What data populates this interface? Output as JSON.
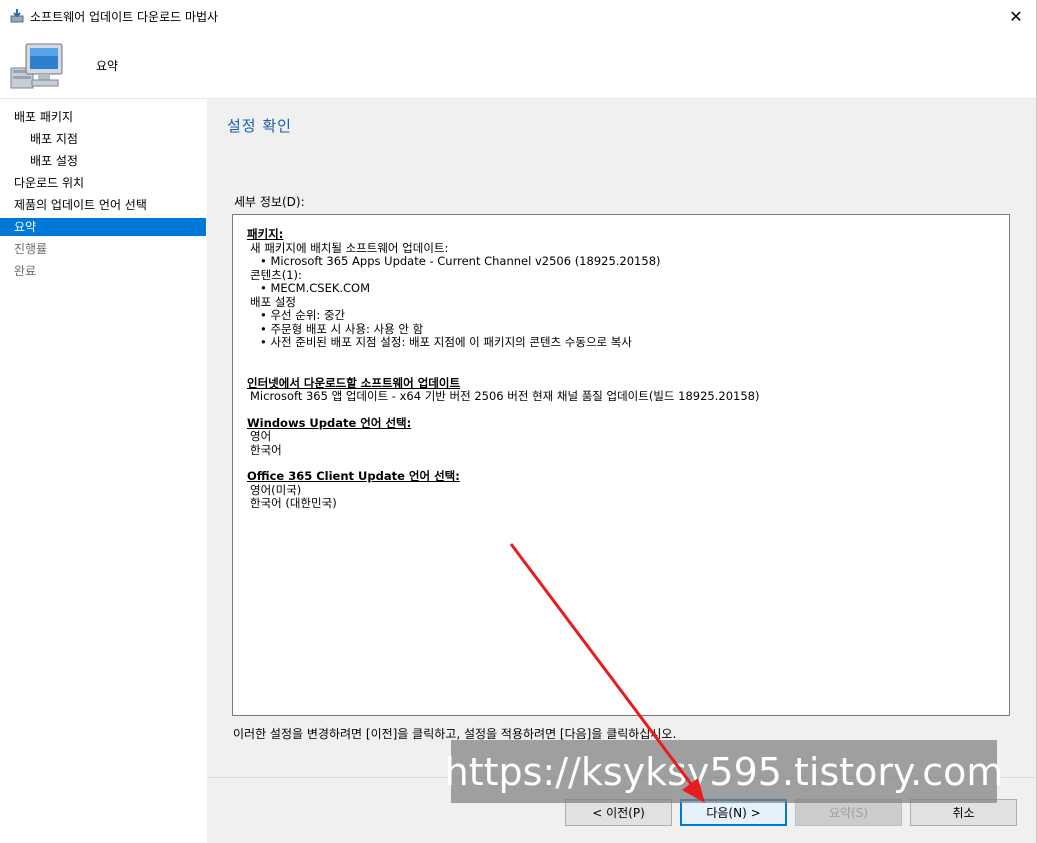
{
  "window": {
    "title": "소프트웨어 업데이트 다운로드 마법사",
    "close_glyph": "✕"
  },
  "header": {
    "title": "요약"
  },
  "nav": {
    "items": [
      {
        "label": "배포 패키지",
        "state": "normal"
      },
      {
        "label": "배포 지점",
        "state": "sub"
      },
      {
        "label": "배포 설정",
        "state": "sub"
      },
      {
        "label": "다운로드 위치",
        "state": "normal"
      },
      {
        "label": "제품의 업데이트 언어 선택",
        "state": "normal"
      },
      {
        "label": "요약",
        "state": "active"
      },
      {
        "label": "진행률",
        "state": "disabled"
      },
      {
        "label": "완료",
        "state": "disabled"
      }
    ]
  },
  "main": {
    "section_title": "설정 확인",
    "details_label": "세부 정보(D):",
    "details": {
      "package_heading": "패키지:",
      "package_sub1": "새 패키지에 배치될 소프트웨어 업데이트:",
      "package_sub1_item": "• Microsoft 365 Apps Update - Current Channel v2506 (18925.20158)",
      "content_label": "콘텐츠(1):",
      "content_item": "• MECM.CSEK.COM",
      "deploy_settings": "배포 설정",
      "deploy_item1": "• 우선 순위: 중간",
      "deploy_item2": "• 주문형 배포 시 사용: 사용 안 함",
      "deploy_item3": "• 사전 준비된 배포 지점 설정: 배포 지점에 이 패키지의 콘텐츠 수동으로 복사",
      "internet_heading": "인터넷에서 다운로드할 소프트웨어 업데이트",
      "internet_item": "Microsoft 365 앱 업데이트 - x64 기반 버전 2506 버전 현재 채널 품질 업데이트(빌드 18925.20158)",
      "wu_heading": "Windows Update 언어 선택:",
      "wu_lang1": "영어",
      "wu_lang2": "한국어",
      "o365_heading": "Office 365 Client Update 언어 선택:",
      "o365_lang1": "영어(미국)",
      "o365_lang2": "한국어 (대한민국)"
    },
    "hint": "이러한 설정을 변경하려면 [이전]을 클릭하고, 설정을 적용하려면 [다음]을 클릭하십시오."
  },
  "buttons": {
    "prev": "< 이전(P)",
    "next": "다음(N) >",
    "summary": "요약(S)",
    "cancel": "취소"
  },
  "watermark": "https://ksyksy595.tistory.com",
  "colors": {
    "accent": "#0078d7",
    "section_title": "#1a5fa8",
    "arrow": "#e81c1c"
  }
}
